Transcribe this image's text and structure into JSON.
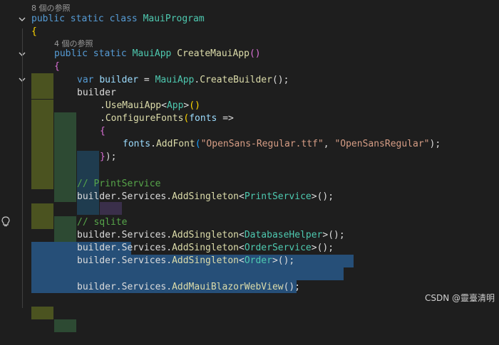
{
  "editor": {
    "codelens_class": "8 個の参照",
    "codelens_method": "4 個の参照",
    "lines": {
      "l1": {
        "kw1": "public",
        "kw2": "static",
        "kw3": "class",
        "name": "MauiProgram"
      },
      "l2": {
        "brace": "{"
      },
      "l3": {
        "kw1": "public",
        "kw2": "static",
        "type": "MauiApp",
        "method": "CreateMauiApp",
        "parens": "()"
      },
      "l4": {
        "brace": "{"
      },
      "l5": {
        "kw": "var",
        "var": "builder",
        "eq": " = ",
        "type": "MauiApp",
        "dot": ".",
        "method": "CreateBuilder",
        "end": "();"
      },
      "l6": {
        "text": "builder"
      },
      "l7": {
        "dot": ".",
        "method": "UseMauiApp",
        "lt": "<",
        "type": "App",
        "gt": ">",
        "end": "()"
      },
      "l8": {
        "dot": ".",
        "method": "ConfigureFonts",
        "open": "(",
        "param": "fonts",
        "arrow": " =>"
      },
      "l9": {
        "brace": "{"
      },
      "l10": {
        "obj": "fonts",
        "dot": ".",
        "method": "AddFont",
        "open": "(",
        "s1": "\"OpenSans-Regular.ttf\"",
        "comma": ", ",
        "s2": "\"OpenSansRegular\"",
        "end": ");"
      },
      "l11": {
        "brace": "}",
        "end": ");"
      },
      "l13": {
        "comment": "// PrintService"
      },
      "l14": {
        "pre": "builder.Services.",
        "method": "AddSingleton",
        "lt": "<",
        "type": "PrintService",
        "gt": ">",
        "end": "();"
      },
      "l16": {
        "comment": "// sqlite"
      },
      "l17": {
        "pre": "builder.Services.",
        "method": "AddSingleton",
        "lt": "<",
        "type": "DatabaseHelper",
        "gt": ">",
        "end": "();"
      },
      "l18": {
        "pre": "builder.Services.",
        "method": "AddSingleton",
        "lt": "<",
        "type": "OrderService",
        "gt": ">",
        "end": "();"
      },
      "l19": {
        "pre": "builder.Services.",
        "method": "AddSingleton",
        "lt": "<",
        "type": "Order",
        "gt": ">",
        "end": "();"
      },
      "l21": {
        "pre": "builder.Services.",
        "method": "AddMauiBlazorWebView",
        "end": "();"
      }
    }
  },
  "watermark": "CSDN @靈臺清明",
  "colors": {
    "background": "#1e1e1e",
    "keyword": "#569cd6",
    "type": "#4ec9b0",
    "method": "#dcdcaa",
    "string": "#d69d85",
    "comment": "#57a64a",
    "selection": "#264f78"
  }
}
